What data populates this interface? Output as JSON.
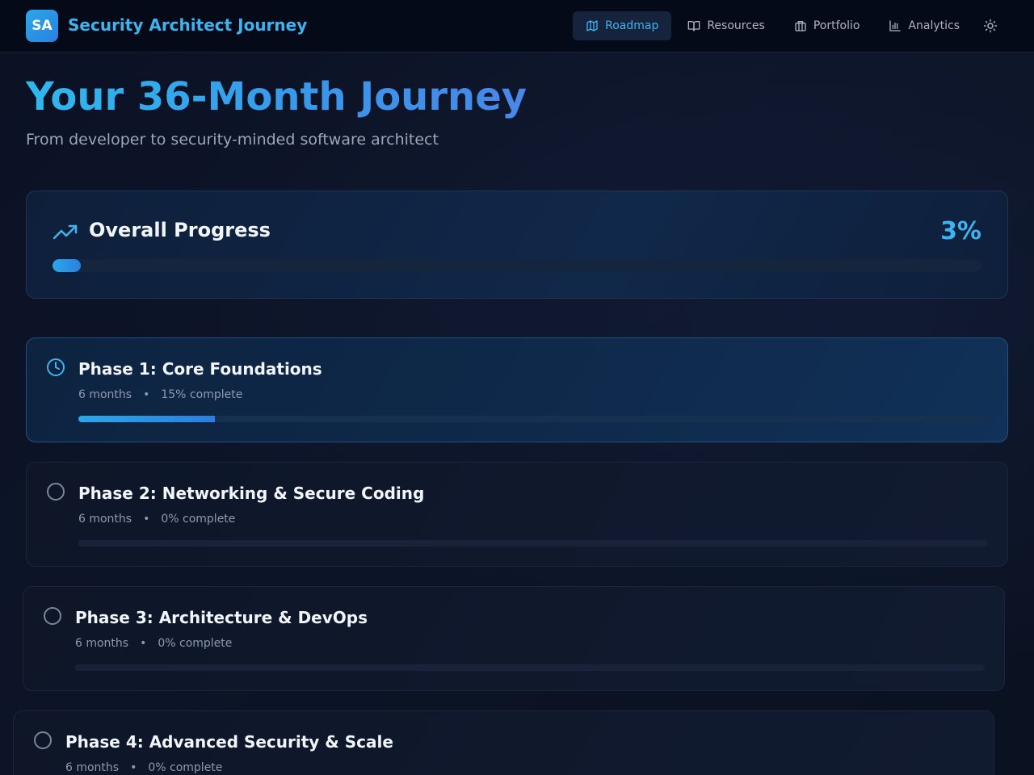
{
  "app": {
    "logo_text": "SA",
    "title": "Security Architect Journey"
  },
  "nav": {
    "items": [
      {
        "label": "Roadmap",
        "icon": "map-icon",
        "active": true
      },
      {
        "label": "Resources",
        "icon": "book-icon",
        "active": false
      },
      {
        "label": "Portfolio",
        "icon": "briefcase-icon",
        "active": false
      },
      {
        "label": "Analytics",
        "icon": "bar-chart-icon",
        "active": false
      }
    ],
    "theme_toggle_icon": "sun-icon"
  },
  "hero": {
    "title": "Your 36-Month Journey",
    "subtitle": "From developer to security-minded software architect"
  },
  "overall": {
    "title": "Overall Progress",
    "percent_label": "3%",
    "progress": 0.03,
    "icon": "trending-up-icon"
  },
  "phases": [
    {
      "title": "Phase 1: Core Foundations",
      "duration": "6 months",
      "separator": "•",
      "status": "15% complete",
      "progress": 0.15,
      "icon": "clock-icon",
      "active": true
    },
    {
      "title": "Phase 2: Networking & Secure Coding",
      "duration": "6 months",
      "separator": "•",
      "status": "0% complete",
      "progress": 0,
      "icon": "circle-icon",
      "active": false
    },
    {
      "title": "Phase 3: Architecture & DevOps",
      "duration": "6 months",
      "separator": "•",
      "status": "0% complete",
      "progress": 0,
      "icon": "circle-icon",
      "active": false
    },
    {
      "title": "Phase 4: Advanced Security & Scale",
      "duration": "6 months",
      "separator": "•",
      "status": "0% complete",
      "progress": 0,
      "icon": "circle-icon",
      "active": false
    }
  ],
  "colors": {
    "accent": "#3fb2f0",
    "bar_start": "#2aa8e8",
    "bar_end": "#2a7fe0"
  }
}
